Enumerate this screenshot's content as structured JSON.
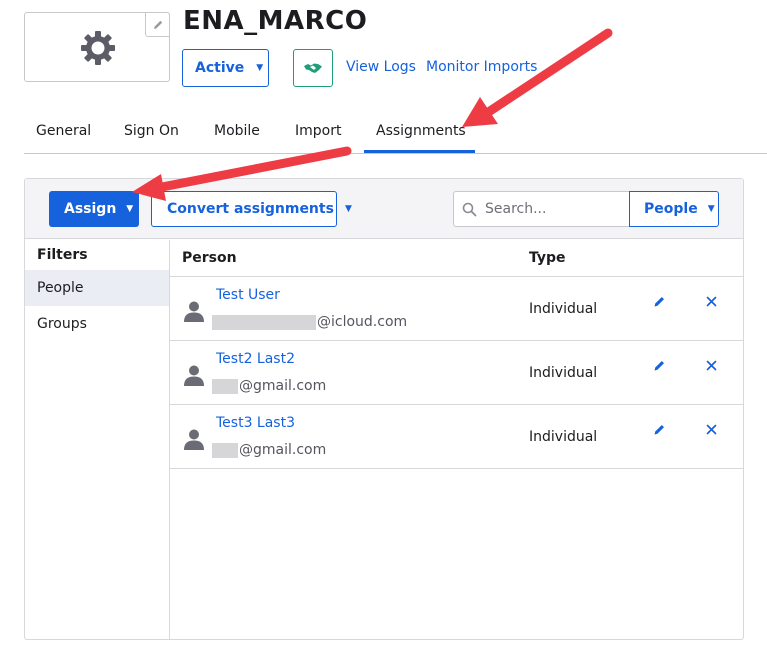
{
  "app": {
    "title": "ENA_MARCO",
    "status_label": "Active",
    "links": [
      "View Logs",
      "Monitor Imports"
    ]
  },
  "tabs": [
    {
      "label": "General"
    },
    {
      "label": "Sign On"
    },
    {
      "label": "Mobile"
    },
    {
      "label": "Import"
    },
    {
      "label": "Assignments",
      "active": true
    }
  ],
  "toolbar": {
    "assign_label": "Assign",
    "convert_label": "Convert assignments",
    "search_placeholder": "Search...",
    "filter_type_label": "People"
  },
  "filters": {
    "title": "Filters",
    "items": [
      {
        "label": "People",
        "selected": true
      },
      {
        "label": "Groups",
        "selected": false
      }
    ]
  },
  "table": {
    "columns": [
      "Person",
      "Type"
    ],
    "rows": [
      {
        "name": "Test User",
        "email_suffix": "@icloud.com",
        "type": "Individual"
      },
      {
        "name": "Test2 Last2",
        "email_suffix": "@gmail.com",
        "type": "Individual"
      },
      {
        "name": "Test3 Last3",
        "email_suffix": "@gmail.com",
        "type": "Individual"
      }
    ]
  },
  "colors": {
    "primary": "#1662dd",
    "accent_green": "#1f9e7a",
    "annotation_arrow": "#ee3c45",
    "selected_filter_bg": "#ebedf5"
  },
  "icons": {
    "logo": "gear-icon",
    "logo_edit": "pencil-icon",
    "integration": "handshake-icon",
    "search": "search-icon",
    "row_edit": "pencil-icon",
    "row_remove": "close-icon",
    "person": "person-icon"
  }
}
